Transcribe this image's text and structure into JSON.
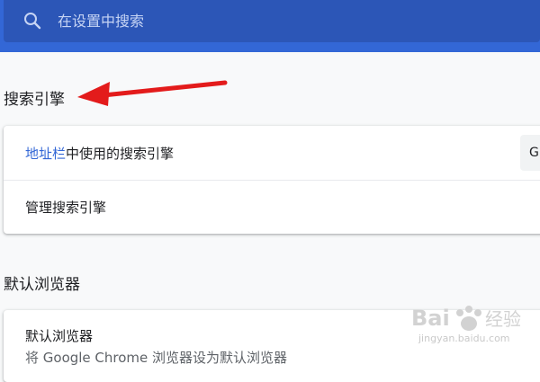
{
  "search": {
    "placeholder": "在设置中搜索",
    "icon": "search-icon"
  },
  "colors": {
    "header_bg": "#3367d6",
    "search_bg": "#2c56b7",
    "link": "#3367d6",
    "annotation_arrow": "#e31b1b"
  },
  "search_engine": {
    "title": "搜索引擎",
    "address_bar_link": "地址栏",
    "address_bar_text": "中使用的搜索引擎",
    "selected_engine": "G",
    "manage_label": "管理搜索引擎"
  },
  "default_browser": {
    "title": "默认浏览器",
    "item_title": "默认浏览器",
    "item_desc": "将 Google Chrome 浏览器设为默认浏览器"
  },
  "watermark": {
    "text_main": "Bai",
    "text_cn": "经验",
    "url": "jingyan.baidu.com"
  }
}
